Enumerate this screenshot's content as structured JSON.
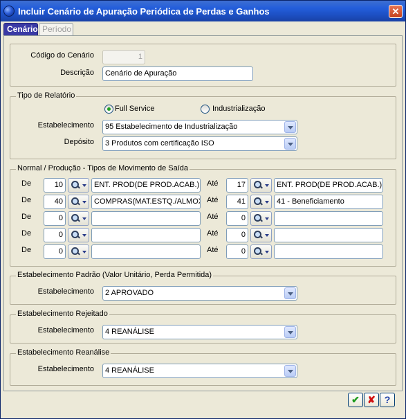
{
  "window": {
    "title": "Incluir Cenário de Apuração Periódica de Perdas e Ganhos",
    "close_label": "✕"
  },
  "tabs": [
    {
      "label": "Cenário",
      "active": true
    },
    {
      "label": "Período",
      "active": false
    }
  ],
  "scenario": {
    "codigo_label": "Código do Cenário",
    "codigo_value": "1",
    "descricao_label": "Descrição",
    "descricao_value": "Cenário de Apuração"
  },
  "tipo_relatorio": {
    "group_title": "Tipo de Relatório",
    "radio_full": "Full Service",
    "radio_ind": "Industrialização",
    "selected": "Full Service",
    "estab_label": "Estabelecimento",
    "estab_value": "95 Estabelecimento de Industrialização",
    "deposito_label": "Depósito",
    "deposito_value": "3 Produtos com certificação ISO"
  },
  "movimento": {
    "group_title": "Normal / Produção - Tipos de Movimento de Saída",
    "de_label": "De",
    "ate_label": "Até",
    "rows": [
      {
        "de_code": "10",
        "de_desc": "ENT. PROD(DE PROD.ACAB.)",
        "ate_code": "17",
        "ate_desc": "ENT. PROD(DE PROD.ACAB.)"
      },
      {
        "de_code": "40",
        "de_desc": "COMPRAS(MAT.ESTQ./ALMOX.)",
        "ate_code": "41",
        "ate_desc": "41 - Beneficiamento"
      },
      {
        "de_code": "0",
        "de_desc": "",
        "ate_code": "0",
        "ate_desc": ""
      },
      {
        "de_code": "0",
        "de_desc": "",
        "ate_code": "0",
        "ate_desc": ""
      },
      {
        "de_code": "0",
        "de_desc": "",
        "ate_code": "0",
        "ate_desc": ""
      }
    ]
  },
  "estab_padrao": {
    "group_title": "Estabelecimento Padrão (Valor Unitário, Perda Permitida)",
    "label": "Estabelecimento",
    "value": "2 APROVADO"
  },
  "estab_rejeitado": {
    "group_title": "Estabelecimento Rejeitado",
    "label": "Estabelecimento",
    "value": "4 REANÁLISE"
  },
  "estab_reanalise": {
    "group_title": "Estabelecimento Reanálise",
    "label": "Estabelecimento",
    "value": "4 REANÁLISE"
  },
  "footer": {
    "ok_label": "✔",
    "cancel_label": "✘",
    "help_label": "?"
  },
  "colors": {
    "ok": "#1a9a1a",
    "cancel": "#d01010",
    "help": "#1c3fa8",
    "titlebar": "#245edb"
  },
  "icons": {
    "lookup": "magnifier-icon",
    "combo": "chevron-down-icon"
  }
}
